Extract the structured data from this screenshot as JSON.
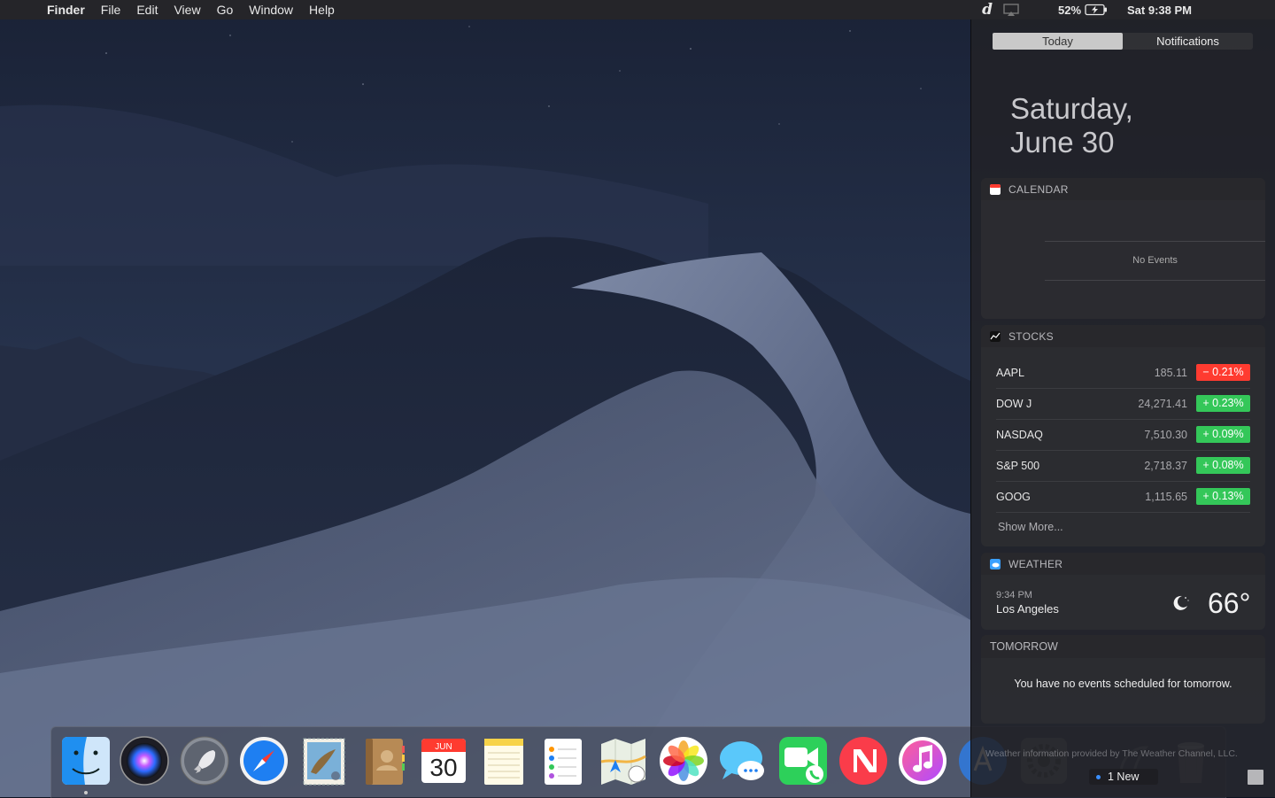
{
  "menubar": {
    "app_name": "Finder",
    "menus": [
      "File",
      "Edit",
      "View",
      "Go",
      "Window",
      "Help"
    ],
    "status_d": "d",
    "battery_percent": "52%",
    "clock": "Sat 9:38 PM"
  },
  "notification_center": {
    "tabs": {
      "today": "Today",
      "notifications": "Notifications"
    },
    "date_line1": "Saturday,",
    "date_line2": "June 30",
    "calendar": {
      "title": "CALENDAR",
      "no_events": "No Events"
    },
    "stocks": {
      "title": "STOCKS",
      "rows": [
        {
          "symbol": "AAPL",
          "price": "185.11",
          "change": "− 0.21%",
          "direction": "down"
        },
        {
          "symbol": "DOW J",
          "price": "24,271.41",
          "change": "+ 0.23%",
          "direction": "up"
        },
        {
          "symbol": "NASDAQ",
          "price": "7,510.30",
          "change": "+ 0.09%",
          "direction": "up"
        },
        {
          "symbol": "S&P 500",
          "price": "2,718.37",
          "change": "+ 0.08%",
          "direction": "up"
        },
        {
          "symbol": "GOOG",
          "price": "1,115.65",
          "change": "+ 0.13%",
          "direction": "up"
        }
      ],
      "show_more": "Show More..."
    },
    "weather": {
      "title": "WEATHER",
      "time": "9:34 PM",
      "city": "Los Angeles",
      "temperature": "66°",
      "icon": "moon-icon"
    },
    "tomorrow": {
      "title": "TOMORROW",
      "message": "You have no events scheduled for tomorrow."
    },
    "attribution": "Weather information provided by The Weather Channel, LLC.",
    "new_badge": "1 New"
  },
  "dock": {
    "calendar_month": "JUN",
    "calendar_day": "30",
    "items": [
      "finder",
      "siri",
      "launchpad",
      "safari",
      "mail",
      "contacts",
      "calendar",
      "notes",
      "reminders",
      "maps",
      "photos",
      "messages",
      "facetime",
      "news",
      "itunes",
      "app-store",
      "system-preferences",
      "unknown-app",
      "trash"
    ]
  },
  "colors": {
    "stock_up": "#34c759",
    "stock_down": "#ff3b30",
    "accent": "#3a8fff"
  }
}
